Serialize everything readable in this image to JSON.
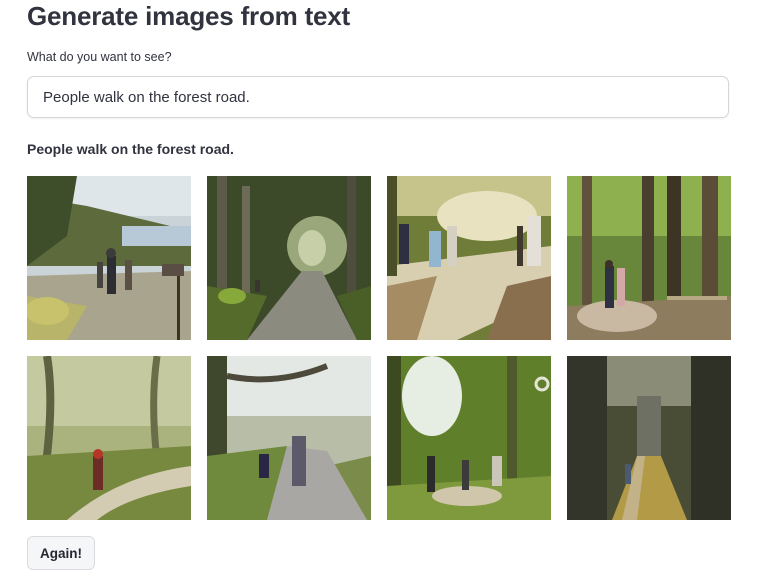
{
  "app": {
    "title": "Generate images from text"
  },
  "prompt": {
    "label": "What do you want to see?",
    "value": "People walk on the forest road."
  },
  "results": {
    "heading": "People walk on the forest road.",
    "images": [
      {
        "name": "generated-image-1",
        "scene": "people walking on open path near sea"
      },
      {
        "name": "generated-image-2",
        "scene": "road through forest tunnel"
      },
      {
        "name": "generated-image-3",
        "scene": "people on sandy forest path"
      },
      {
        "name": "generated-image-4",
        "scene": "couple walking among tall trees"
      },
      {
        "name": "generated-image-5",
        "scene": "figure on misty woodland path"
      },
      {
        "name": "generated-image-6",
        "scene": "person walking on road in fog"
      },
      {
        "name": "generated-image-7",
        "scene": "group of people in green forest"
      },
      {
        "name": "generated-image-8",
        "scene": "dark forest avenue with walker"
      }
    ]
  },
  "actions": {
    "again_label": "Again!"
  }
}
